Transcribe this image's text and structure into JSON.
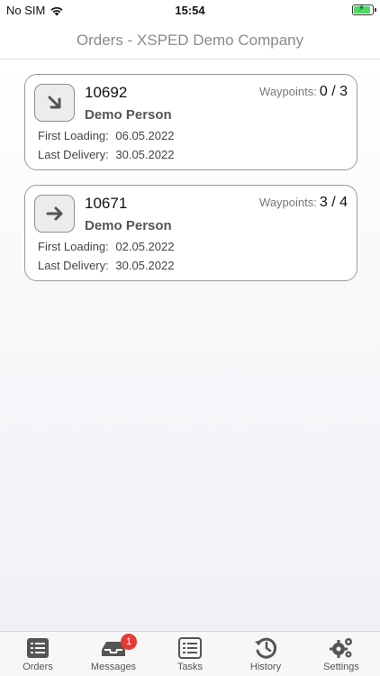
{
  "status_bar": {
    "carrier": "No SIM",
    "time": "15:54"
  },
  "nav": {
    "title": "Orders - XSPED Demo Company"
  },
  "orders": [
    {
      "id": "10692",
      "person": "Demo Person",
      "waypoints_label": "Waypoints:",
      "waypoints_value": "0 / 3",
      "first_loading_label": "First Loading:",
      "first_loading_value": "06.05.2022",
      "last_delivery_label": "Last Delivery:",
      "last_delivery_value": "30.05.2022",
      "icon": "arrow-down-right-icon"
    },
    {
      "id": "10671",
      "person": "Demo Person",
      "waypoints_label": "Waypoints:",
      "waypoints_value": "3 / 4",
      "first_loading_label": "First Loading:",
      "first_loading_value": "02.05.2022",
      "last_delivery_label": "Last Delivery:",
      "last_delivery_value": "30.05.2022",
      "icon": "arrow-right-icon"
    }
  ],
  "tabs": [
    {
      "label": "Orders",
      "icon": "list-icon"
    },
    {
      "label": "Messages",
      "icon": "inbox-icon",
      "badge": "1"
    },
    {
      "label": "Tasks",
      "icon": "tasks-list-icon"
    },
    {
      "label": "History",
      "icon": "history-icon"
    },
    {
      "label": "Settings",
      "icon": "gears-icon"
    }
  ],
  "colors": {
    "accent": "#555555",
    "badge": "#e53a35",
    "battery": "#4cd964"
  }
}
